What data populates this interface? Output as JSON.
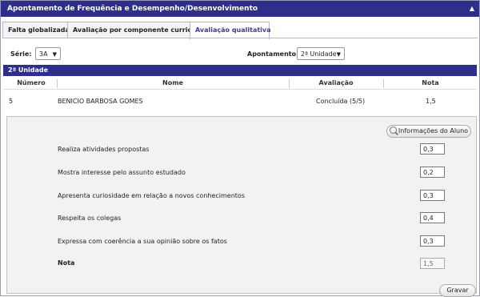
{
  "window": {
    "title": "Apontamento de Frequência e Desempenho/Desenvolvimento",
    "collapse_icon": "▲"
  },
  "tabs": [
    {
      "label": "Falta globalizada",
      "active": false
    },
    {
      "label": "Avaliação por componente curricular",
      "active": false
    },
    {
      "label": "Avaliação qualitativa",
      "active": true
    }
  ],
  "filters": {
    "serie_label": "Série:",
    "serie_value": "3A",
    "apontamento_label": "Apontamento:",
    "apontamento_value": "2ª Unidade"
  },
  "unit_header": "2ª Unidade",
  "table": {
    "columns": [
      "Número",
      "Nome",
      "Avaliação",
      "Nota"
    ],
    "row": {
      "numero": "5",
      "nome": "BENICIO BARBOSA GOMES",
      "avaliacao": "Concluída (5/5)",
      "nota": "1,5"
    }
  },
  "details": {
    "info_button": "Informações do Aluno",
    "criteria": [
      {
        "label": "Realiza atividades propostas",
        "value": "0,3"
      },
      {
        "label": "Mostra interesse pelo assunto estudado",
        "value": "0,2"
      },
      {
        "label": "Apresenta curiosidade em relação a novos conhecimentos",
        "value": "0,3"
      },
      {
        "label": "Respeita os colegas",
        "value": "0,4"
      },
      {
        "label": "Expressa com coerência a sua opinião sobre os fatos",
        "value": "0,3"
      }
    ],
    "total_label": "Nota",
    "total_value": "1,5"
  },
  "actions": {
    "save": "Gravar"
  },
  "colors": {
    "header_bg": "#2e2e8c",
    "active_tab_text": "#3a3a98",
    "panel_bg": "#f2f2f2"
  }
}
